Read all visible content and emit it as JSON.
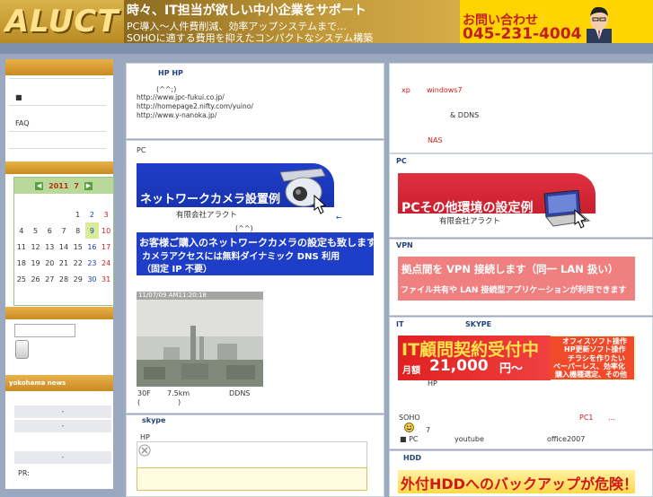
{
  "header": {
    "logo": "ALUCT",
    "tagline": "時々、IT担当が欲しい中小企業をサポート",
    "sub1": "PC導入～人件費削減、効率アップシステムまで…",
    "sub2": "SOHOに適する費用を抑えたコンパクトなシステム構築",
    "contact_label": "お問い合わせ",
    "phone": "045-231-4004"
  },
  "sidebar": {
    "bullet": "■",
    "faq": "FAQ",
    "calendar": {
      "year": "2011",
      "month": "7",
      "prev": "◀",
      "next": "▶",
      "weeks": [
        [
          "",
          "",
          "",
          "",
          "1",
          "2",
          "3"
        ],
        [
          "4",
          "5",
          "6",
          "7",
          "8",
          "9",
          "10"
        ],
        [
          "11",
          "12",
          "13",
          "14",
          "15",
          "16",
          "17"
        ],
        [
          "18",
          "19",
          "20",
          "21",
          "22",
          "23",
          "24"
        ],
        [
          "25",
          "26",
          "27",
          "28",
          "29",
          "30",
          "31"
        ]
      ],
      "today": "9"
    },
    "news_title": "yokohama news",
    "news_items": [
      "-",
      "-",
      "-"
    ],
    "pr_label": "PR:"
  },
  "main": {
    "hp_title": "HP  HP",
    "smiley": "(^^;)",
    "urls": [
      "http://www.jpc-fukui.co.jp/",
      "http://homepage2.nifty.com/yuino/",
      "http://www.y-nanoka.jp/"
    ],
    "pc_label": "PC",
    "camera_banner": "ネットワークカメラ設置例",
    "camera_company": "有限会社アラクト",
    "arrow": "←",
    "smiley2": "(^^)",
    "promo1": "お客様ご購入のネットワークカメラの設定も致します",
    "promo2": "カメラアクセスには無料ダイナミック DNS 利用",
    "promo3": "（固定 IP 不要）",
    "cam_timestamp": "11/07/09  AM11:20:18",
    "cam_info_floor": "30F",
    "cam_info_dist": "7.5km",
    "cam_info_ddns": "DDNS",
    "cam_paren_open": "(",
    "cam_paren_close": ")",
    "skype_title": "skype",
    "skype_hp": "HP"
  },
  "right": {
    "xp": "xp",
    "win7": "windows7",
    "amp_ddns": "&  DDNS",
    "nas": "NAS",
    "pc_title": "PC",
    "pc_banner": "PCその他環境の設定例",
    "pc_company": "有限会社アラクト",
    "vpn_title": "VPN",
    "vpn1": "拠点間を VPN 接続します（同一 LAN 扱い）",
    "vpn2": "ファイル共有や LAN 接続型アプリケーションが利用できます",
    "it_title": "IT",
    "skype_title": "SKYPE",
    "it_banner": "IT顧問契約受付中",
    "it_price_label": "月額",
    "it_price": "21,000",
    "it_price_unit": "円～",
    "it_side": [
      "オフィスソフト操作",
      "HP更新ソフト操作",
      "チラシを作りたい",
      "ペーパーレス、効率化",
      "購入機種選定、その他"
    ],
    "it_hp": "HP",
    "soho": "SOHO",
    "pc1": "PC1",
    "dots": "…",
    "seven": "7",
    "pc_bullet": "■ PC",
    "youtube": "youtube",
    "office": "office2007",
    "hdd_title": "HDD",
    "hdd_banner": "外付HDDへのバックアップが危険！"
  },
  "colors": {
    "accent": "#ffd400",
    "banner_blue": "#1f3ec8",
    "banner_red": "#d92030",
    "pink": "#f08080"
  }
}
